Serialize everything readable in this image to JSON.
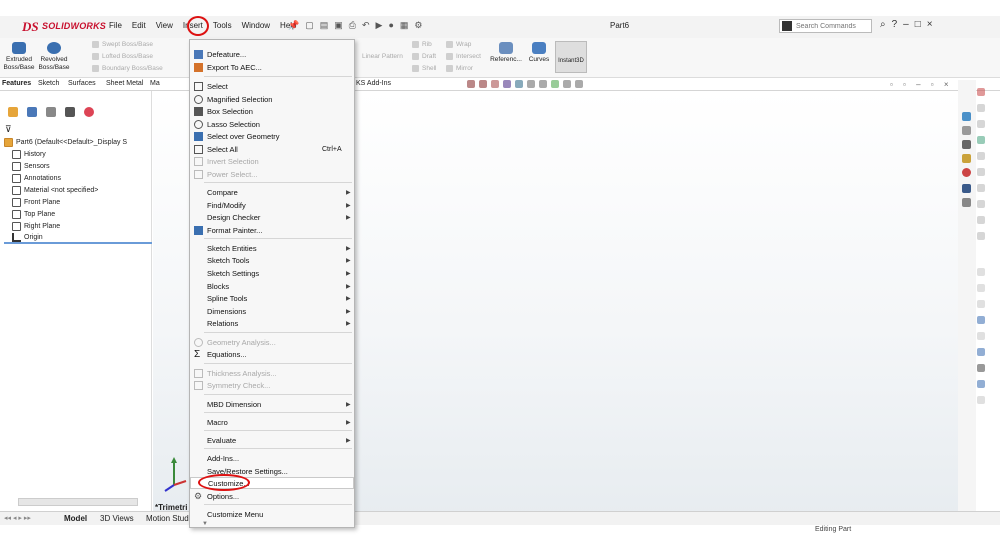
{
  "app": {
    "logo_ds": "DS",
    "logo_text": "SOLIDWORKS",
    "document_title": "Part6",
    "search_placeholder": "Search Commands"
  },
  "menubar": [
    "File",
    "Edit",
    "View",
    "Insert",
    "Tools",
    "Window",
    "Help"
  ],
  "right_controls": [
    "?",
    "–",
    "□",
    "×"
  ],
  "command_manager": {
    "extruded": "Extruded\nBoss/Base",
    "revolved": "Revolved\nBoss/Base",
    "swept": "Swept Boss/Base",
    "lofted": "Lofted Boss/Base",
    "boundary": "Boundary Boss/Base",
    "linear_pattern": "Linear Pattern",
    "rib": "Rib",
    "wrap": "Wrap",
    "draft": "Draft",
    "intersect": "Intersect",
    "shell": "Shell",
    "mirror": "Mirror",
    "reference": "Referenc...",
    "curves": "Curves",
    "instant3d": "Instant3D"
  },
  "tabs": [
    "Features",
    "Sketch",
    "Surfaces",
    "Sheet Metal",
    "Ma"
  ],
  "tab_addins": "KS Add-Ins",
  "feature_tree": [
    {
      "label": "Part6  (Default<<Default>_Display S",
      "icon": "part-icon"
    },
    {
      "label": "History",
      "icon": "history-icon"
    },
    {
      "label": "Sensors",
      "icon": "sensors-icon"
    },
    {
      "label": "Annotations",
      "icon": "annotations-icon"
    },
    {
      "label": "Material <not specified>",
      "icon": "material-icon"
    },
    {
      "label": "Front Plane",
      "icon": "plane-icon"
    },
    {
      "label": "Top Plane",
      "icon": "plane-icon"
    },
    {
      "label": "Right Plane",
      "icon": "plane-icon"
    },
    {
      "label": "Origin",
      "icon": "origin-icon"
    }
  ],
  "tools_menu": {
    "items": [
      {
        "label": "Defeature...",
        "icon": "defeature-icon",
        "enabled": true
      },
      {
        "label": "Export To AEC...",
        "icon": "export-aec-icon",
        "enabled": true
      },
      {
        "label": "Select",
        "icon": "select-icon",
        "enabled": true
      },
      {
        "label": "Magnified Selection",
        "icon": "magnified-selection-icon",
        "enabled": true
      },
      {
        "label": "Box Selection",
        "icon": "box-selection-icon",
        "enabled": true
      },
      {
        "label": "Lasso Selection",
        "icon": "lasso-selection-icon",
        "enabled": true
      },
      {
        "label": "Select over Geometry",
        "icon": "select-over-geometry-icon",
        "enabled": true
      },
      {
        "label": "Select All",
        "icon": "select-all-icon",
        "enabled": true,
        "shortcut": "Ctrl+A"
      },
      {
        "label": "Invert Selection",
        "icon": "invert-selection-icon",
        "enabled": false
      },
      {
        "label": "Power Select...",
        "icon": "power-select-icon",
        "enabled": false
      },
      {
        "label": "Compare",
        "submenu": true,
        "enabled": true
      },
      {
        "label": "Find/Modify",
        "submenu": true,
        "enabled": true
      },
      {
        "label": "Design Checker",
        "submenu": true,
        "enabled": true
      },
      {
        "label": "Format Painter...",
        "icon": "format-painter-icon",
        "enabled": true
      },
      {
        "label": "Sketch Entities",
        "submenu": true,
        "enabled": true
      },
      {
        "label": "Sketch Tools",
        "submenu": true,
        "enabled": true
      },
      {
        "label": "Sketch Settings",
        "submenu": true,
        "enabled": true
      },
      {
        "label": "Blocks",
        "submenu": true,
        "enabled": true
      },
      {
        "label": "Spline Tools",
        "submenu": true,
        "enabled": true
      },
      {
        "label": "Dimensions",
        "submenu": true,
        "enabled": true
      },
      {
        "label": "Relations",
        "submenu": true,
        "enabled": true
      },
      {
        "label": "Geometry Analysis...",
        "icon": "geometry-analysis-icon",
        "enabled": false
      },
      {
        "label": "Equations...",
        "icon": "sigma-icon",
        "enabled": true
      },
      {
        "label": "Thickness Analysis...",
        "icon": "thickness-analysis-icon",
        "enabled": false
      },
      {
        "label": "Symmetry Check...",
        "icon": "symmetry-check-icon",
        "enabled": false
      },
      {
        "label": "MBD Dimension",
        "submenu": true,
        "enabled": true
      },
      {
        "label": "Macro",
        "submenu": true,
        "enabled": true
      },
      {
        "label": "Evaluate",
        "submenu": true,
        "enabled": true
      },
      {
        "label": "Add-Ins...",
        "enabled": true
      },
      {
        "label": "Save/Restore Settings...",
        "enabled": true
      },
      {
        "label": "Customize...",
        "enabled": true,
        "highlighted": true
      },
      {
        "label": "Options...",
        "icon": "gear-icon",
        "enabled": true
      },
      {
        "label": "Customize Menu",
        "enabled": true
      }
    ]
  },
  "view_label": "*Trimetri",
  "bottom_tabs": [
    "Model",
    "3D Views",
    "Motion Stud"
  ],
  "status_right": "Editing Part",
  "colors": {
    "brand_red": "#c8102e",
    "highlight_ring": "#dd1111",
    "selection_blue": "#6a9bd8"
  }
}
